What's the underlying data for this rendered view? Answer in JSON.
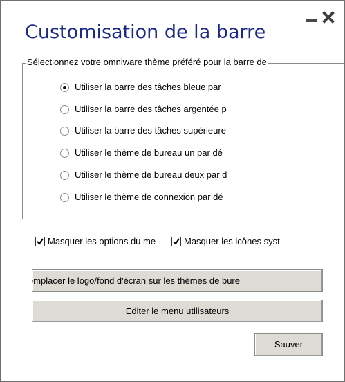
{
  "window": {
    "title": "Customisation de la barre"
  },
  "theme_group": {
    "label": "Sélectionnez votre omniware thème préféré pour la barre de",
    "options": [
      {
        "label": "Utiliser la barre des tâches bleue par",
        "selected": true
      },
      {
        "label": "Utiliser la barre des tâches argentée p",
        "selected": false
      },
      {
        "label": "Utiliser la barre des tâches supérieure",
        "selected": false
      },
      {
        "label": "Utiliser le thème de bureau un par dé",
        "selected": false
      },
      {
        "label": "Utiliser le thème de bureau deux par d",
        "selected": false
      },
      {
        "label": "Utiliser le thème de connexion par dé",
        "selected": false
      }
    ]
  },
  "checkboxes": [
    {
      "label": "Masquer les options du me",
      "checked": true
    },
    {
      "label": "Masquer les icônes syst",
      "checked": true
    }
  ],
  "buttons": {
    "replace_logo": "emplacer le logo/fond d'écran sur les thèmes de bure",
    "edit_menu": "Editer le menu utilisateurs",
    "save": "Sauver"
  }
}
